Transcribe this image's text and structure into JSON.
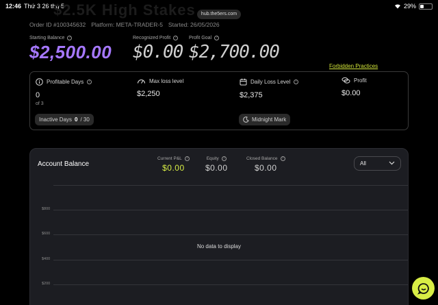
{
  "statusbar": {
    "time": "12:46",
    "date": "Thứ 3 26 thg 5",
    "battery": "29%",
    "battery_level": 0.29
  },
  "browser": {
    "url": "hub.the5ers.com"
  },
  "header": {
    "ghost_title": "$2.5K High Stakes",
    "order_id": "Order ID #100345632",
    "platform": "Platform: META-TRADER-5",
    "started": "Started: 26/05/2026"
  },
  "balances": {
    "starting_label": "Starting Balance",
    "starting_value": "$2,500.00",
    "recognized_label": "Recognized Profit",
    "recognized_value": "$0.00",
    "goal_label": "Profit Goal",
    "goal_value": "$2,700.00"
  },
  "links": {
    "forbidden": "Forbidden Practices"
  },
  "stats": {
    "profitable_days_label": "Profitable Days",
    "profitable_days_value": "0",
    "profitable_days_of": "of 3",
    "inactive_days_label": "Inactive Days",
    "inactive_days_value": "0",
    "inactive_days_total": "/ 30",
    "max_loss_label": "Max loss level",
    "max_loss_value": "$2,250",
    "daily_loss_label": "Daily Loss Level",
    "daily_loss_value": "$2,375",
    "midnight_label": "Midnight Mark",
    "profit_label": "Profit",
    "profit_value": "$0.00"
  },
  "account_balance": {
    "title": "Account Balance",
    "current_pnl_label": "Current P&L",
    "current_pnl_value": "$0.00",
    "equity_label": "Equity",
    "equity_value": "$0.00",
    "closed_balance_label": "Closed Balance",
    "closed_balance_value": "$0.00",
    "filter_value": "All",
    "no_data": "No data to display",
    "y_ticks": [
      "$800",
      "$600",
      "$400",
      "$200"
    ]
  },
  "colors": {
    "accent_purple": "#a678ff",
    "accent_lime": "#d8ee45",
    "card_bg": "#1c1d22"
  },
  "icons": [
    "wifi-icon",
    "battery-icon",
    "info-icon",
    "gauge-icon",
    "calendar-icon",
    "coins-icon",
    "moon-icon",
    "chevron-down-icon",
    "chat-icon"
  ]
}
